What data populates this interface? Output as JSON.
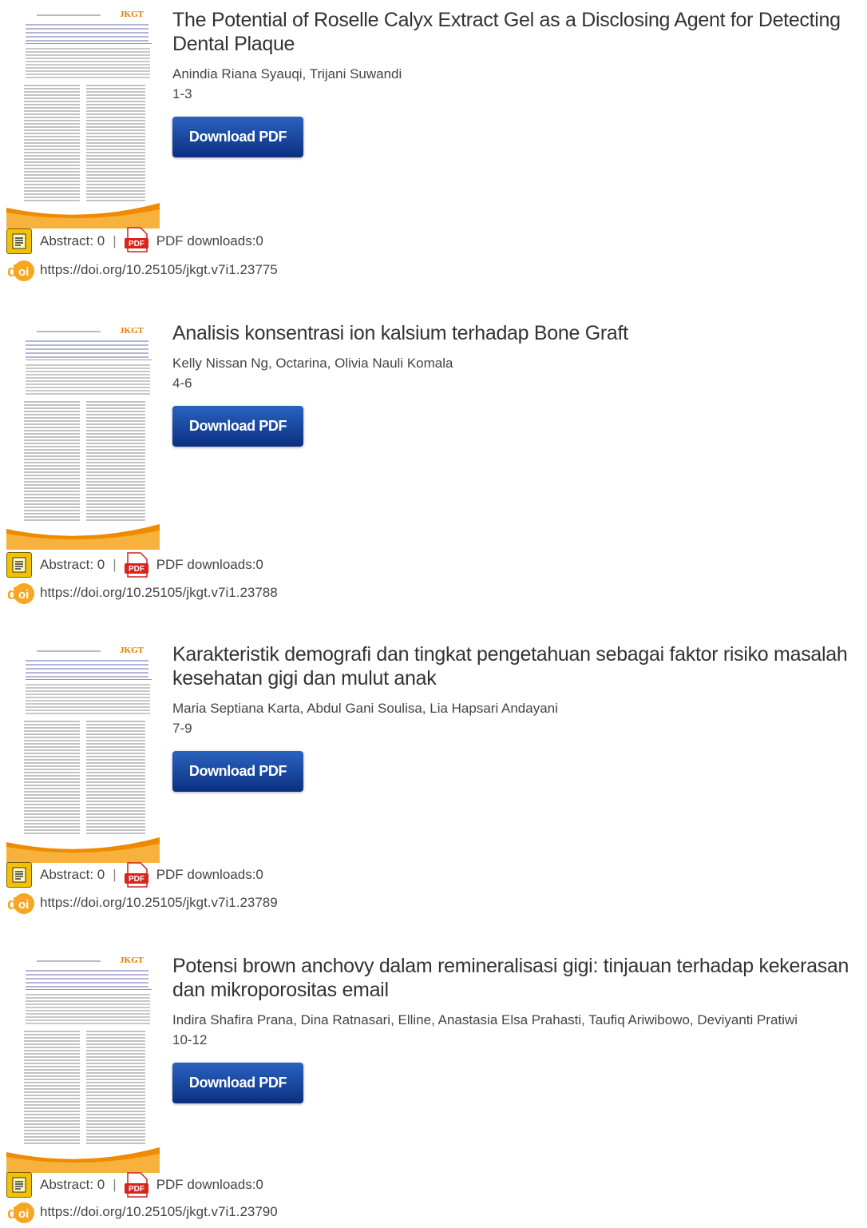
{
  "articles": [
    {
      "title": "The Potential of Roselle Calyx Extract Gel as a Disclosing Agent for Detecting Dental Plaque",
      "authors": "Anindia Riana Syauqi, Trijani Suwandi",
      "pages": "1-3",
      "download_label": "Download PDF",
      "abstract_label": "Abstract: 0",
      "separator": "|",
      "pdf_label": "PDF downloads:0",
      "doi": "https://doi.org/10.25105/jkgt.v7i1.23775",
      "thumb_logo": "JKGT"
    },
    {
      "title": "Analisis konsentrasi ion kalsium terhadap Bone Graft",
      "authors": "Kelly Nissan Ng, Octarina, Olivia Nauli Komala",
      "pages": "4-6",
      "download_label": "Download PDF",
      "abstract_label": "Abstract: 0",
      "separator": "|",
      "pdf_label": "PDF downloads:0",
      "doi": "https://doi.org/10.25105/jkgt.v7i1.23788",
      "thumb_logo": "JKGT"
    },
    {
      "title": "Karakteristik demografi dan tingkat pengetahuan sebagai faktor risiko masalah kesehatan gigi dan mulut anak",
      "authors": "Maria Septiana Karta, Abdul Gani Soulisa, Lia Hapsari Andayani",
      "pages": "7-9",
      "download_label": "Download PDF",
      "abstract_label": "Abstract: 0",
      "separator": "|",
      "pdf_label": "PDF downloads:0",
      "doi": "https://doi.org/10.25105/jkgt.v7i1.23789",
      "thumb_logo": "JKGT"
    },
    {
      "title": "Potensi brown anchovy dalam remineralisasi gigi: tinjauan terhadap kekerasan dan mikroporositas email",
      "authors": "Indira Shafira Prana, Dina Ratnasari, Elline, Anastasia Elsa Prahasti, Taufiq Ariwibowo, Deviyanti Pratiwi",
      "pages": "10-12",
      "download_label": "Download PDF",
      "abstract_label": "Abstract: 0",
      "separator": "|",
      "pdf_label": "PDF downloads:0",
      "doi": "https://doi.org/10.25105/jkgt.v7i1.23790",
      "thumb_logo": "JKGT"
    }
  ],
  "icons": {
    "abstract": "abstract-document-icon",
    "pdf": "pdf-file-icon",
    "doi": "doi-logo-icon"
  },
  "colors": {
    "button_top": "#2a63c0",
    "button_bottom": "#0b2f80",
    "thumb_accent": "#f08a00",
    "doi_orange": "#f6a623"
  },
  "doi_icon_text": {
    "d": "d",
    "oi": "oi"
  },
  "pdf_icon_text": "PDF"
}
